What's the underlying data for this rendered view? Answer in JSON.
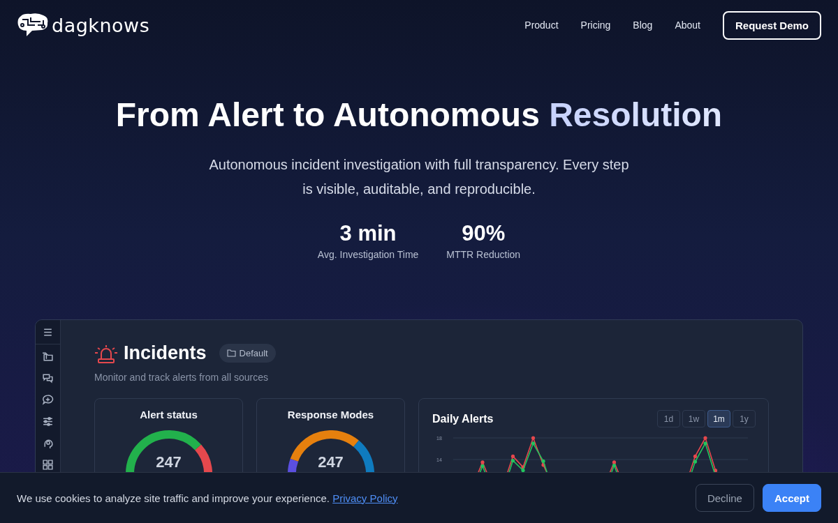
{
  "nav": {
    "logo": "dagknows",
    "links": [
      {
        "label": "Product"
      },
      {
        "label": "Pricing"
      },
      {
        "label": "Blog"
      },
      {
        "label": "About"
      }
    ],
    "cta": "Request Demo"
  },
  "hero": {
    "title": "From Alert to Autonomous",
    "title_accent": "Resolution",
    "subtitle": "Autonomous incident investigation with full transparency. Every step is visible, auditable, and reproducible.",
    "stats": [
      {
        "value": "3 min",
        "label": "Avg. Investigation Time"
      },
      {
        "value": "90%",
        "label": "MTTR Reduction"
      }
    ]
  },
  "dashboard": {
    "title": "Incidents",
    "badge": "Default",
    "subtitle": "Monitor and track alerts from all sources",
    "cards": [
      {
        "title": "Alert status",
        "total": "247",
        "kind": "status"
      },
      {
        "title": "Response Modes",
        "total": "247",
        "kind": "modes"
      }
    ],
    "daily": {
      "title": "Daily Alerts",
      "ranges": [
        {
          "label": "1d",
          "selected": false
        },
        {
          "label": "1w",
          "selected": false
        },
        {
          "label": "1m",
          "selected": true
        },
        {
          "label": "1y",
          "selected": false
        }
      ],
      "axis_labels": [
        "18",
        "14"
      ]
    }
  },
  "cookie": {
    "text": "We use cookies to analyze site traffic and improve your experience.",
    "link": "Privacy Policy",
    "decline": "Decline",
    "accept": "Accept"
  }
}
